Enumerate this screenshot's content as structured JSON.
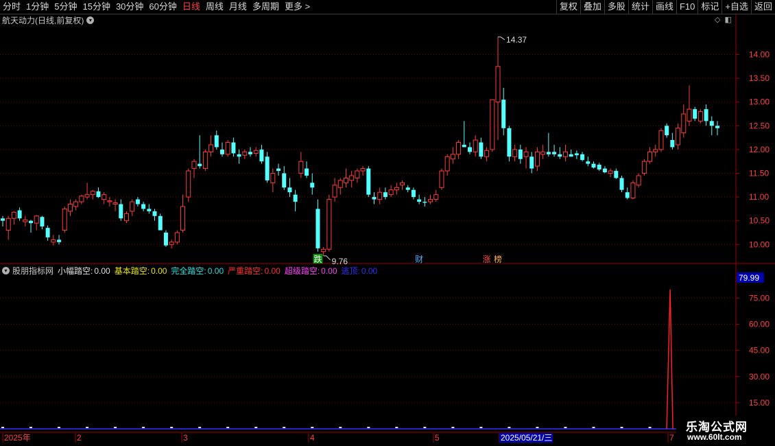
{
  "toolbar": {
    "period_tabs": [
      "分时",
      "1分钟",
      "5分钟",
      "15分钟",
      "30分钟",
      "60分钟",
      "日线",
      "周线",
      "月线",
      "多周期",
      "更多 >"
    ],
    "active_tab": "日线",
    "right_tools": [
      "复权",
      "叠加",
      "多股",
      "统计",
      "画线",
      "F10",
      "标记",
      "+自选",
      "返回"
    ]
  },
  "stock": {
    "title": "航天动力(日线,前复权)",
    "high_label": "14.37",
    "low_label": "9.76",
    "event_markers": [
      "跌",
      "财",
      "涨",
      "榜"
    ]
  },
  "indicator": {
    "name": "股朋指标网",
    "items": [
      {
        "label": "小幅踏空:",
        "value": "0.00",
        "color": "#e0e0e0"
      },
      {
        "label": "基本踏空:",
        "value": "0.00",
        "color": "#e8e800"
      },
      {
        "label": "完全踏空:",
        "value": "0.00",
        "color": "#20e0e0"
      },
      {
        "label": "严重踏空:",
        "value": "0.00",
        "color": "#ff3030"
      },
      {
        "label": "超级踏空:",
        "value": "0.00",
        "color": "#ff40ff"
      },
      {
        "label": "逃顶:",
        "value": "0.00",
        "color": "#3030ff"
      }
    ],
    "current_value_box": "79.99",
    "spike_peak": 79.99
  },
  "axes": {
    "price_ticks": [
      "14.00",
      "13.50",
      "13.00",
      "12.50",
      "12.00",
      "11.50",
      "11.00",
      "10.50",
      "10.00"
    ],
    "indicator_ticks": [
      "75.00",
      "60.00",
      "45.00",
      "30.00",
      "15.00"
    ],
    "date_labels": [
      "2025年",
      "2",
      "3",
      "4",
      "5",
      "2025/05/21/三",
      "7"
    ]
  },
  "watermark": {
    "title": "乐淘公式网",
    "url": "www.60lt.com"
  },
  "colors": {
    "up": "#ff3c3c",
    "down": "#54ffff",
    "grid": "#7a0000",
    "axis_line": "#a00000",
    "price_label": "#ff4040",
    "crosshair_box": "#0000aa"
  },
  "chart_data": {
    "type": "candlestick",
    "title": "航天动力(日线,前复权)",
    "ylim": [
      9.6,
      14.6
    ],
    "candles": [
      [
        10.55,
        10.6,
        10.38,
        10.5
      ],
      [
        10.3,
        10.6,
        10.1,
        10.55
      ],
      [
        10.55,
        10.7,
        10.42,
        10.68
      ],
      [
        10.72,
        10.78,
        10.5,
        10.55
      ],
      [
        10.48,
        10.6,
        10.38,
        10.52
      ],
      [
        10.5,
        10.52,
        10.25,
        10.45
      ],
      [
        10.45,
        10.62,
        10.3,
        10.6
      ],
      [
        10.58,
        10.6,
        10.32,
        10.38
      ],
      [
        10.35,
        10.4,
        10.08,
        10.15
      ],
      [
        10.05,
        10.2,
        9.98,
        10.1
      ],
      [
        10.1,
        10.2,
        10.0,
        10.05
      ],
      [
        10.3,
        10.8,
        10.25,
        10.75
      ],
      [
        10.7,
        10.95,
        10.6,
        10.85
      ],
      [
        10.8,
        10.95,
        10.72,
        10.9
      ],
      [
        10.9,
        11.05,
        10.85,
        11.02
      ],
      [
        11.0,
        11.3,
        10.95,
        11.05
      ],
      [
        11.05,
        11.15,
        10.95,
        11.12
      ],
      [
        11.12,
        11.2,
        10.98,
        11.0
      ],
      [
        10.95,
        11.1,
        10.85,
        11.05
      ],
      [
        10.9,
        11.0,
        10.8,
        10.92
      ],
      [
        10.85,
        10.95,
        10.7,
        10.88
      ],
      [
        10.85,
        10.95,
        10.5,
        10.55
      ],
      [
        10.5,
        10.7,
        10.45,
        10.65
      ],
      [
        10.7,
        10.95,
        10.6,
        10.9
      ],
      [
        10.95,
        11.0,
        10.8,
        10.85
      ],
      [
        10.85,
        10.9,
        10.7,
        10.75
      ],
      [
        10.75,
        10.85,
        10.65,
        10.7
      ],
      [
        10.7,
        10.75,
        10.5,
        10.6
      ],
      [
        10.6,
        10.65,
        10.3,
        10.3
      ],
      [
        10.25,
        10.3,
        9.95,
        9.98
      ],
      [
        10.0,
        10.1,
        9.92,
        10.05
      ],
      [
        10.05,
        10.3,
        10.0,
        10.25
      ],
      [
        10.3,
        11.05,
        10.25,
        10.8
      ],
      [
        11.0,
        11.6,
        10.9,
        11.55
      ],
      [
        11.6,
        11.8,
        11.4,
        11.75
      ],
      [
        11.7,
        12.3,
        11.6,
        11.65
      ],
      [
        11.6,
        12.0,
        11.55,
        11.95
      ],
      [
        11.95,
        12.3,
        11.85,
        12.1
      ],
      [
        12.3,
        12.4,
        12.0,
        12.05
      ],
      [
        12.0,
        12.15,
        11.85,
        11.9
      ],
      [
        11.9,
        12.2,
        11.85,
        12.15
      ],
      [
        12.15,
        12.25,
        11.85,
        11.92
      ],
      [
        11.9,
        12.0,
        11.7,
        11.85
      ],
      [
        11.88,
        12.0,
        11.8,
        11.95
      ],
      [
        11.95,
        12.05,
        11.85,
        11.9
      ],
      [
        11.92,
        12.05,
        11.85,
        11.98
      ],
      [
        12.0,
        12.1,
        11.7,
        11.75
      ],
      [
        11.85,
        11.95,
        11.3,
        11.35
      ],
      [
        11.3,
        11.6,
        11.1,
        11.5
      ],
      [
        11.6,
        11.7,
        11.45,
        11.55
      ],
      [
        11.5,
        11.65,
        11.15,
        11.2
      ],
      [
        11.2,
        11.4,
        11.0,
        11.1
      ],
      [
        11.05,
        11.15,
        10.7,
        10.9
      ],
      [
        11.5,
        11.95,
        11.4,
        11.75
      ],
      [
        11.6,
        11.75,
        11.4,
        11.45
      ],
      [
        11.3,
        11.5,
        11.05,
        11.2
      ],
      [
        10.75,
        10.95,
        9.85,
        9.92
      ],
      [
        9.85,
        9.95,
        9.76,
        9.9
      ],
      [
        9.9,
        11.05,
        9.85,
        10.95
      ],
      [
        11.0,
        11.4,
        10.9,
        11.25
      ],
      [
        11.2,
        11.4,
        11.05,
        11.35
      ],
      [
        11.3,
        11.6,
        11.2,
        11.4
      ],
      [
        11.35,
        11.55,
        11.2,
        11.45
      ],
      [
        11.4,
        11.6,
        11.3,
        11.55
      ],
      [
        11.55,
        11.65,
        11.45,
        11.6
      ],
      [
        11.6,
        11.65,
        11.0,
        11.05
      ],
      [
        11.0,
        11.1,
        10.85,
        10.95
      ],
      [
        10.95,
        11.2,
        10.85,
        11.1
      ],
      [
        11.1,
        11.2,
        10.95,
        11.0
      ],
      [
        11.05,
        11.25,
        11.0,
        11.15
      ],
      [
        11.15,
        11.3,
        11.05,
        11.2
      ],
      [
        11.25,
        11.35,
        11.15,
        11.3
      ],
      [
        11.2,
        11.25,
        11.1,
        11.15
      ],
      [
        11.15,
        11.2,
        10.95,
        11.0
      ],
      [
        10.95,
        11.05,
        10.85,
        10.9
      ],
      [
        10.9,
        11.0,
        10.8,
        10.88
      ],
      [
        10.9,
        11.05,
        10.85,
        10.95
      ],
      [
        10.95,
        11.15,
        10.9,
        11.05
      ],
      [
        11.2,
        11.6,
        11.15,
        11.55
      ],
      [
        11.55,
        11.9,
        11.45,
        11.85
      ],
      [
        11.8,
        12.05,
        11.7,
        11.9
      ],
      [
        11.9,
        12.2,
        11.8,
        12.15
      ],
      [
        12.1,
        12.6,
        12.05,
        12.05
      ],
      [
        12.05,
        12.15,
        11.9,
        11.95
      ],
      [
        11.95,
        12.3,
        11.85,
        12.2
      ],
      [
        12.15,
        12.25,
        11.8,
        11.85
      ],
      [
        11.85,
        12.05,
        11.75,
        11.98
      ],
      [
        12.0,
        13.05,
        11.95,
        13.05
      ],
      [
        13.0,
        14.37,
        12.2,
        13.75
      ],
      [
        13.05,
        13.3,
        12.3,
        12.45
      ],
      [
        12.45,
        12.5,
        11.75,
        11.85
      ],
      [
        11.85,
        12.1,
        11.75,
        12.0
      ],
      [
        12.0,
        12.1,
        11.7,
        11.8
      ],
      [
        11.85,
        12.05,
        11.6,
        11.95
      ],
      [
        11.85,
        11.95,
        11.5,
        11.6
      ],
      [
        11.65,
        12.05,
        11.55,
        11.95
      ],
      [
        11.9,
        12.1,
        11.8,
        11.95
      ],
      [
        11.95,
        12.35,
        11.85,
        11.9
      ],
      [
        11.95,
        12.1,
        11.85,
        11.9
      ],
      [
        11.9,
        12.05,
        11.8,
        11.85
      ],
      [
        11.85,
        12.1,
        11.75,
        11.95
      ],
      [
        11.9,
        12.0,
        11.85,
        11.85
      ],
      [
        11.92,
        11.98,
        11.8,
        11.88
      ],
      [
        11.9,
        11.95,
        11.75,
        11.78
      ],
      [
        11.75,
        11.85,
        11.65,
        11.7
      ],
      [
        11.7,
        11.75,
        11.6,
        11.62
      ],
      [
        11.68,
        11.72,
        11.55,
        11.58
      ],
      [
        11.6,
        11.65,
        11.5,
        11.52
      ],
      [
        11.5,
        11.6,
        11.42,
        11.55
      ],
      [
        11.55,
        11.6,
        11.38,
        11.4
      ],
      [
        11.4,
        11.45,
        11.1,
        11.15
      ],
      [
        11.1,
        11.2,
        10.95,
        10.98
      ],
      [
        10.98,
        11.35,
        10.95,
        11.3
      ],
      [
        11.25,
        11.5,
        11.2,
        11.45
      ],
      [
        11.5,
        11.8,
        11.45,
        11.75
      ],
      [
        11.75,
        12.05,
        11.7,
        11.95
      ],
      [
        11.95,
        12.1,
        11.85,
        12.0
      ],
      [
        12.0,
        12.45,
        11.95,
        12.4
      ],
      [
        12.5,
        12.55,
        12.25,
        12.3
      ],
      [
        12.2,
        12.35,
        12.0,
        12.05
      ],
      [
        12.1,
        12.55,
        12.0,
        12.45
      ],
      [
        12.35,
        12.95,
        12.25,
        12.75
      ],
      [
        12.6,
        13.35,
        12.5,
        12.85
      ],
      [
        12.85,
        12.9,
        12.6,
        12.65
      ],
      [
        12.6,
        12.85,
        12.55,
        12.8
      ],
      [
        12.85,
        12.95,
        12.5,
        12.6
      ],
      [
        12.6,
        12.7,
        12.3,
        12.5
      ],
      [
        12.5,
        12.6,
        12.3,
        12.45
      ]
    ],
    "price_labels": {
      "max": "14.37",
      "min": "9.76"
    },
    "indicator_series": {
      "names": [
        "小幅踏空",
        "基本踏空",
        "完全踏空",
        "严重踏空",
        "超级踏空",
        "逃顶"
      ],
      "latest_values": [
        0,
        0,
        0,
        0,
        0,
        0
      ],
      "spike_value": 79.99
    },
    "ylabel": "",
    "xlabel": ""
  }
}
